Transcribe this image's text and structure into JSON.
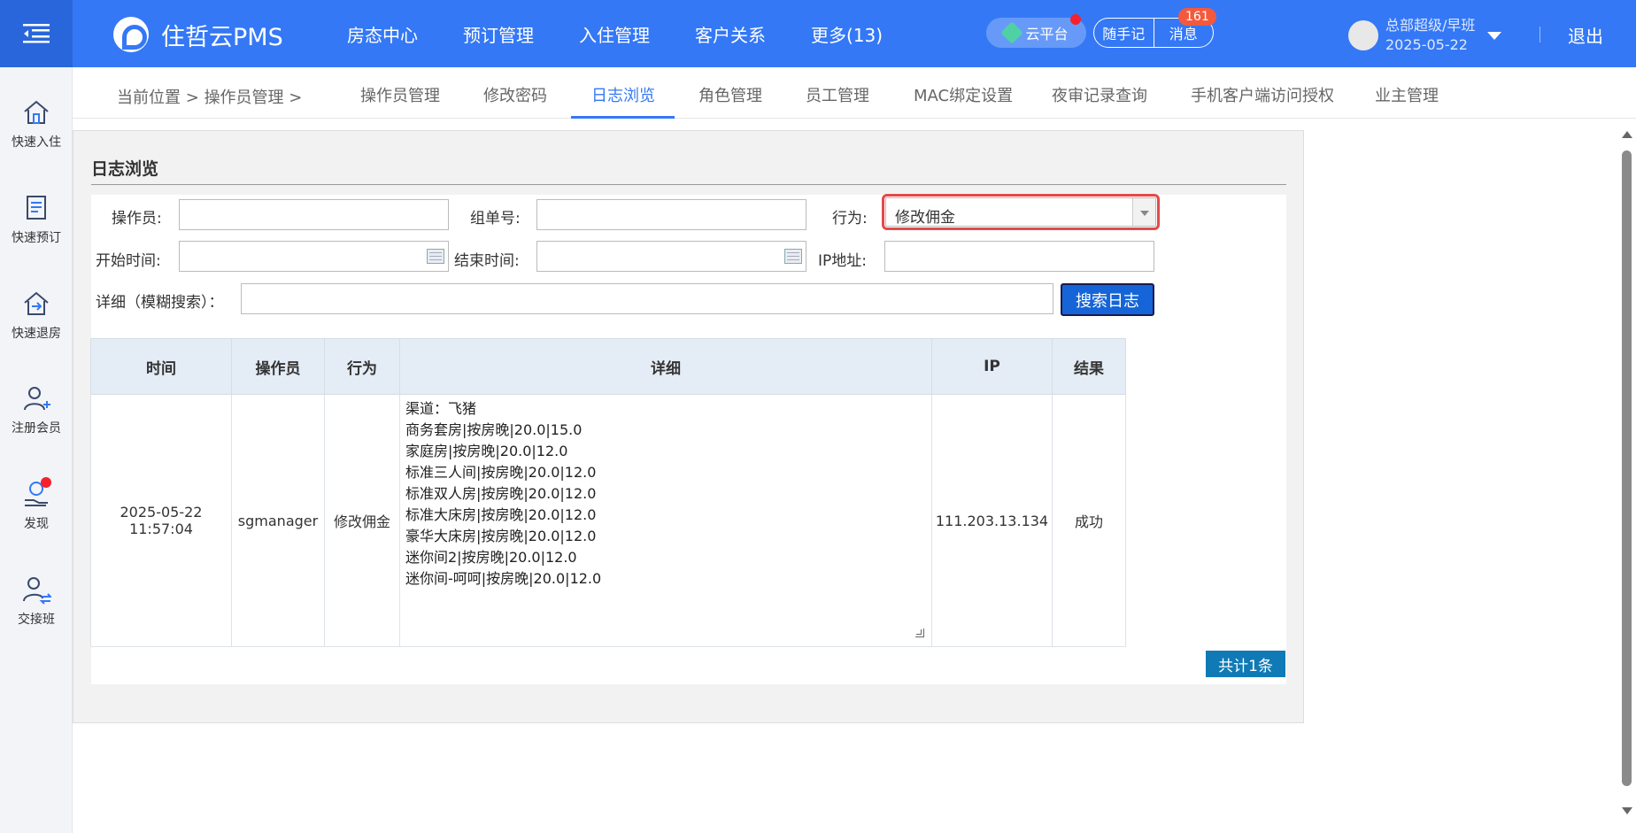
{
  "header": {
    "app_name": "住哲云PMS",
    "nav": [
      "房态中心",
      "预订管理",
      "入住管理",
      "客户关系",
      "更多(13)"
    ],
    "cloud_label": "云平台",
    "notes_label": "随手记",
    "messages_label": "消息",
    "messages_count": "161",
    "user_role": "总部超级/早班",
    "user_date": "2025-05-22",
    "logout_label": "退出"
  },
  "sidebar": {
    "items": [
      {
        "label": "快速入住",
        "icon": "home-icon"
      },
      {
        "label": "快速预订",
        "icon": "document-icon"
      },
      {
        "label": "快速退房",
        "icon": "checkout-icon"
      },
      {
        "label": "注册会员",
        "icon": "add-user-icon"
      },
      {
        "label": "发现",
        "icon": "money-hand-icon"
      },
      {
        "label": "交接班",
        "icon": "shift-change-icon"
      }
    ]
  },
  "breadcrumb": {
    "prefix": "当前位置",
    "sep": ">",
    "current": "操作员管理"
  },
  "tabs": [
    "操作员管理",
    "修改密码",
    "日志浏览",
    "角色管理",
    "员工管理",
    "MAC绑定设置",
    "夜审记录查询",
    "手机客户端访问授权",
    "业主管理"
  ],
  "active_tab": "日志浏览",
  "panel": {
    "title": "日志浏览",
    "form": {
      "operator_label": "操作员:",
      "operator_value": "",
      "group_no_label": "组单号:",
      "group_no_value": "",
      "action_label": "行为:",
      "action_value": "修改佣金",
      "start_time_label": "开始时间:",
      "start_time_value": "",
      "end_time_label": "结束时间:",
      "end_time_value": "",
      "ip_label": "IP地址:",
      "ip_value": "",
      "detail_label": "详细（模糊搜索）：",
      "detail_value": "",
      "search_button": "搜索日志"
    },
    "table": {
      "columns": [
        "时间",
        "操作员",
        "行为",
        "详细",
        "IP",
        "结果"
      ],
      "rows": [
        {
          "time_date": "2025-05-22",
          "time_clock": "11:57:04",
          "operator": "sgmanager",
          "action": "修改佣金",
          "detail": "渠道：飞猪\n商务套房|按房晚|20.0|15.0\n家庭房|按房晚|20.0|12.0\n标准三人间|按房晚|20.0|12.0\n标准双人房|按房晚|20.0|12.0\n标准大床房|按房晚|20.0|12.0\n豪华大床房|按房晚|20.0|12.0\n迷你间2|按房晚|20.0|12.0\n迷你间-呵呵|按房晚|20.0|12.0",
          "ip": "111.203.13.134",
          "result": "成功"
        }
      ]
    },
    "total_label": "共计1条"
  },
  "colors": {
    "primary": "#3478f6",
    "highlight_border": "#e34a4a",
    "total_badge": "#0f7ab5"
  }
}
